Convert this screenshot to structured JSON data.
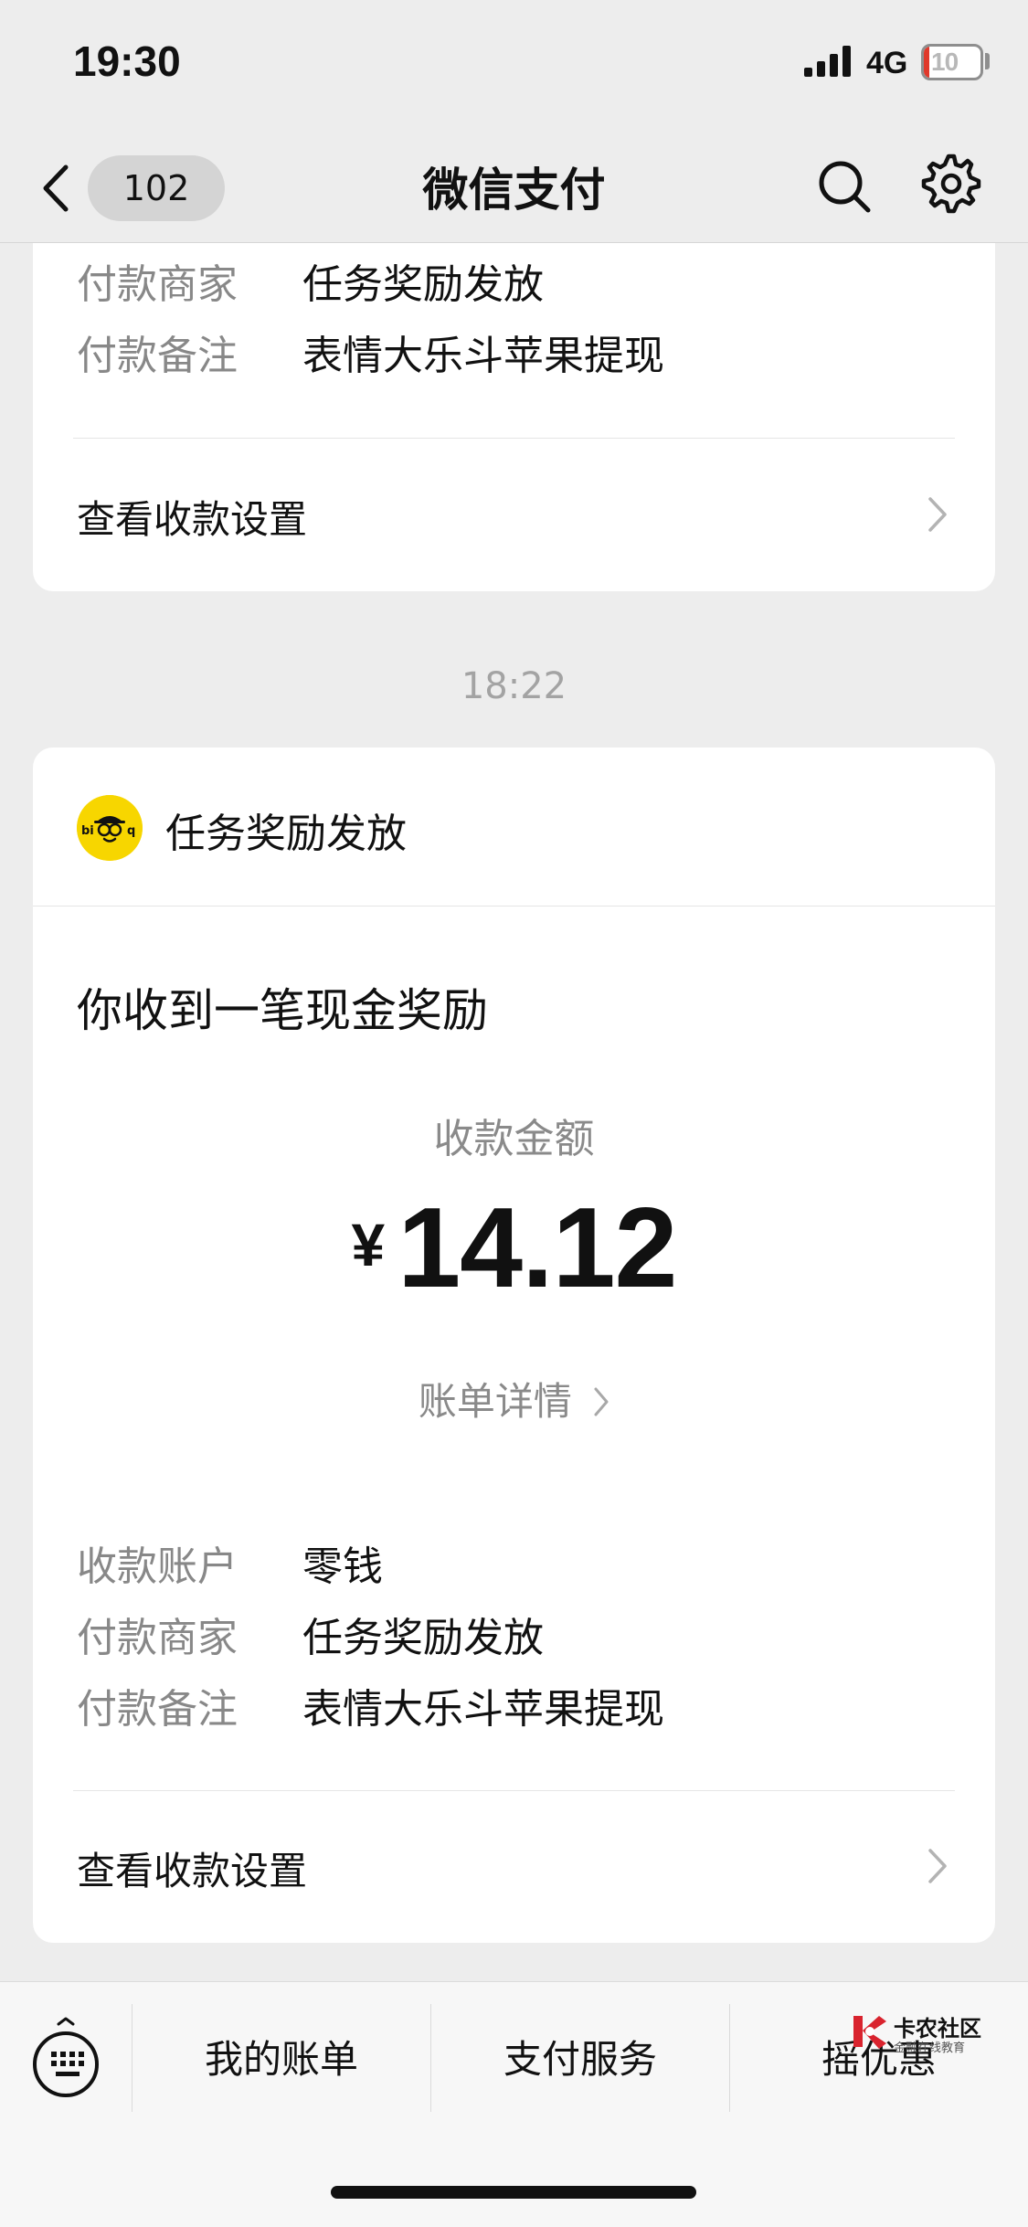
{
  "status_bar": {
    "time": "19:30",
    "network": "4G",
    "battery_level": "10",
    "battery_fraction": 0.1,
    "battery_color": "#e0392b"
  },
  "nav": {
    "back_count": "102",
    "title": "微信支付",
    "search_icon": "search-icon",
    "settings_icon": "gear-icon"
  },
  "previous_message": {
    "details": [
      {
        "label": "付款商家",
        "value": "任务奖励发放"
      },
      {
        "label": "付款备注",
        "value": "表情大乐斗苹果提现"
      }
    ],
    "settings_link": "查看收款设置"
  },
  "timestamp": "18:22",
  "message": {
    "merchant_name": "任务奖励发放",
    "merchant_logo_text": "biaoq",
    "title": "你收到一笔现金奖励",
    "amount_label": "收款金额",
    "currency": "¥",
    "amount": "14.12",
    "bill_detail": "账单详情",
    "details": [
      {
        "label": "收款账户",
        "value": "零钱"
      },
      {
        "label": "付款商家",
        "value": "任务奖励发放"
      },
      {
        "label": "付款备注",
        "value": "表情大乐斗苹果提现"
      }
    ],
    "settings_link": "查看收款设置"
  },
  "bottom_menu": {
    "keyboard_icon": "keyboard-icon",
    "items": [
      "我的账单",
      "支付服务",
      "摇优惠"
    ]
  },
  "watermark": {
    "title": "卡农社区",
    "subtitle": "金融在线教育"
  },
  "colors": {
    "background": "#ededed",
    "card": "#ffffff",
    "secondary_text": "#888888",
    "avatar_yellow": "#f7d600"
  }
}
